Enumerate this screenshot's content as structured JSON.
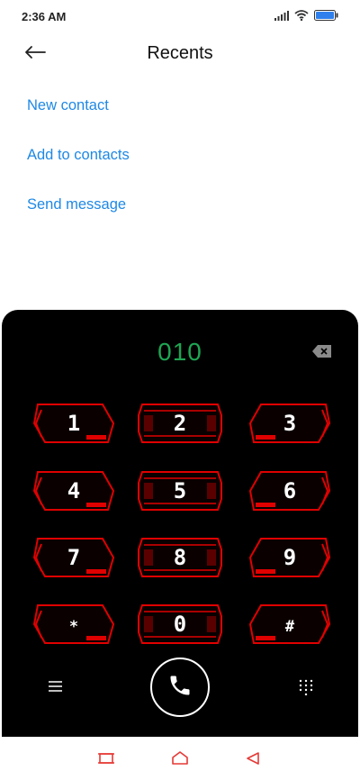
{
  "status_bar": {
    "time": "2:36 AM"
  },
  "header": {
    "title": "Recents"
  },
  "actions": [
    {
      "label": "New contact"
    },
    {
      "label": "Add to contacts"
    },
    {
      "label": "Send message"
    }
  ],
  "dialer": {
    "number": "010",
    "keys": [
      "1",
      "2",
      "3",
      "4",
      "5",
      "6",
      "7",
      "8",
      "9",
      "*",
      "0",
      "#"
    ]
  },
  "colors": {
    "accent": "#1e88e5",
    "dial_number": "#1fa552",
    "key_frame": "#e00000",
    "nav_icons": "#e53935",
    "dialer_bg": "#000000"
  }
}
